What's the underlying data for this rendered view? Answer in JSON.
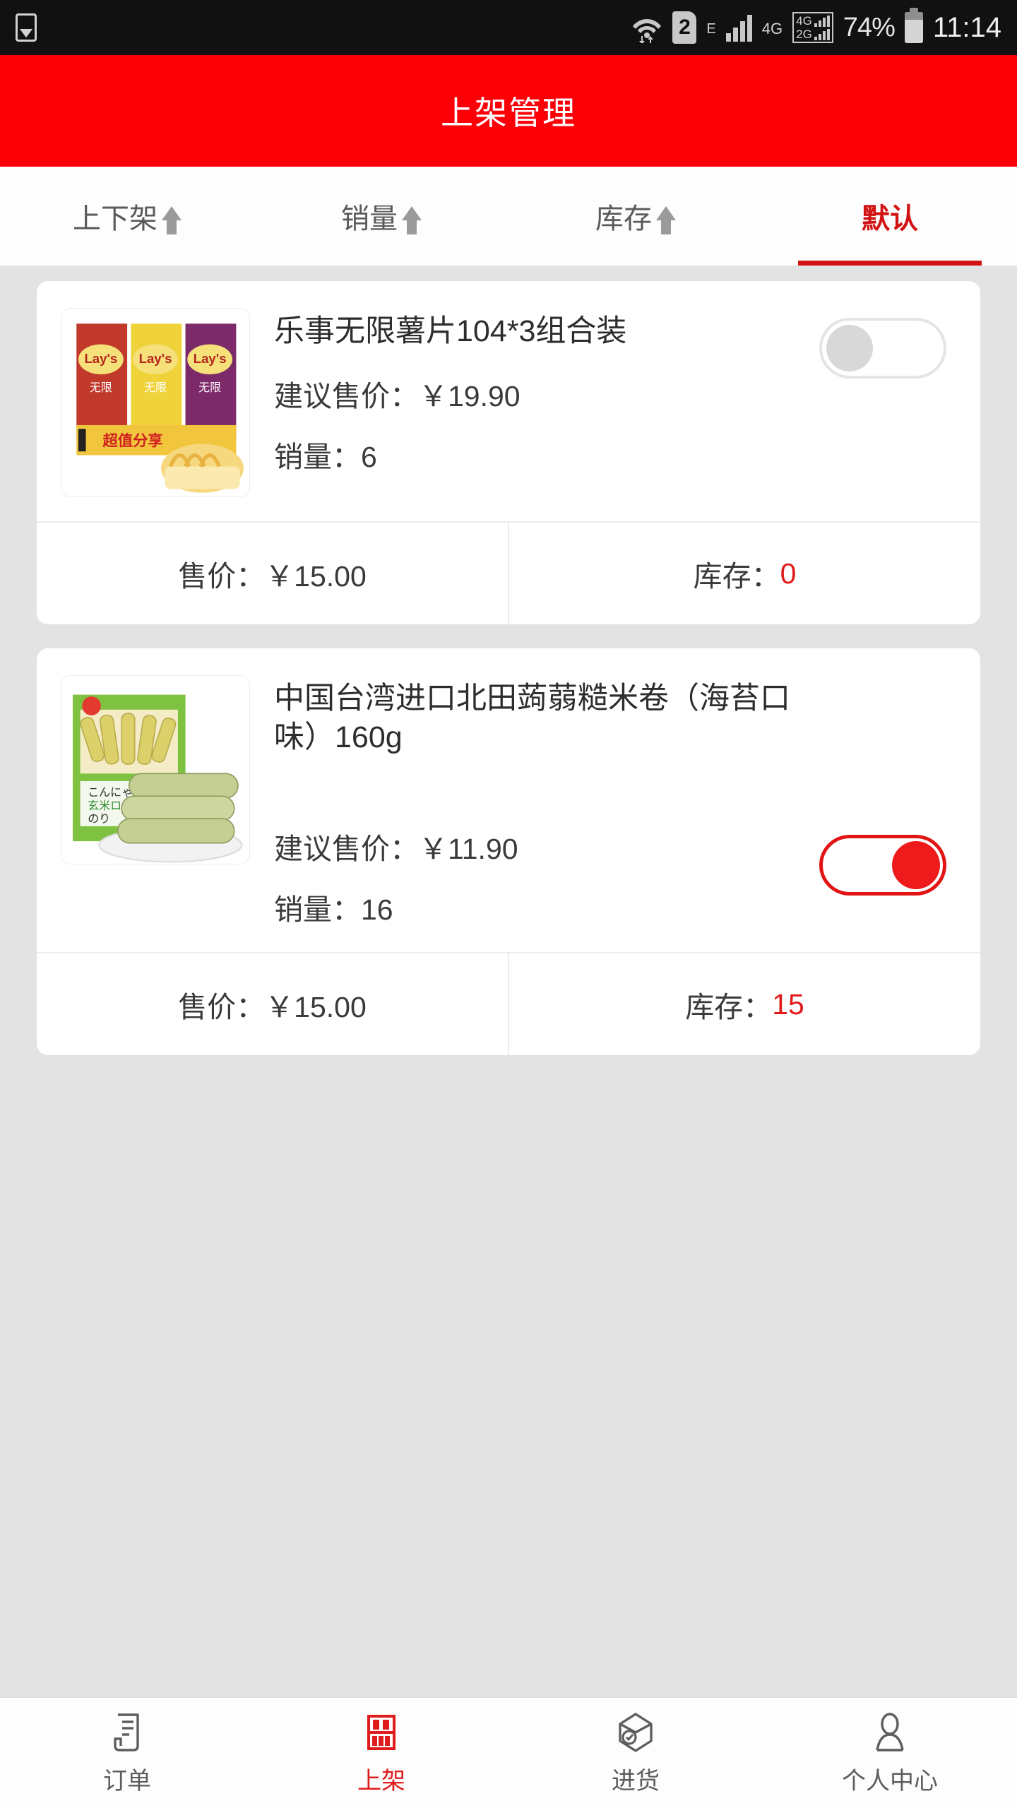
{
  "status_bar": {
    "photo_icon": "photo-icon",
    "wifi_icon": "wifi-icon",
    "sim_label": "2",
    "edge_label": "E",
    "signal_icon": "signal-bars-icon",
    "network_label": "4G",
    "dual_network_top": "4G",
    "dual_network_bottom": "2G",
    "battery_percent": "74%",
    "battery_icon": "battery-icon",
    "time": "11:14"
  },
  "header": {
    "title": "上架管理"
  },
  "tabs": [
    {
      "label": "上下架",
      "sort_icon": "arrow-up-icon",
      "active": false
    },
    {
      "label": "销量",
      "sort_icon": "arrow-up-icon",
      "active": false
    },
    {
      "label": "库存",
      "sort_icon": "arrow-up-icon",
      "active": false
    },
    {
      "label": "默认",
      "sort_icon": "",
      "active": true
    }
  ],
  "products": [
    {
      "image_name": "lays-chips-combo-thumbnail",
      "name": "乐事无限薯片104*3组合装",
      "suggested_price": "建议售价：￥19.90",
      "sales": "销量：6",
      "toggle_state": "off",
      "price_label": "售价：￥15.00",
      "stock_prefix": "库存：",
      "stock_value": "0"
    },
    {
      "image_name": "beitian-rice-rolls-thumbnail",
      "name": "中国台湾进口北田蒟蒻糙米卷（海苔口味）160g",
      "suggested_price": "建议售价：￥11.90",
      "sales": "销量：16",
      "toggle_state": "on",
      "price_label": "售价：￥15.00",
      "stock_prefix": "库存：",
      "stock_value": "15"
    }
  ],
  "bottom_nav": [
    {
      "label": "订单",
      "icon": "receipt-icon",
      "active": false
    },
    {
      "label": "上架",
      "icon": "shelf-icon",
      "active": true
    },
    {
      "label": "进货",
      "icon": "box-icon",
      "active": false
    },
    {
      "label": "个人中心",
      "icon": "person-icon",
      "active": false
    }
  ],
  "colors": {
    "brand_red": "#fb0007",
    "accent_red": "#e01b1b",
    "page_bg": "#e3e3e3"
  }
}
